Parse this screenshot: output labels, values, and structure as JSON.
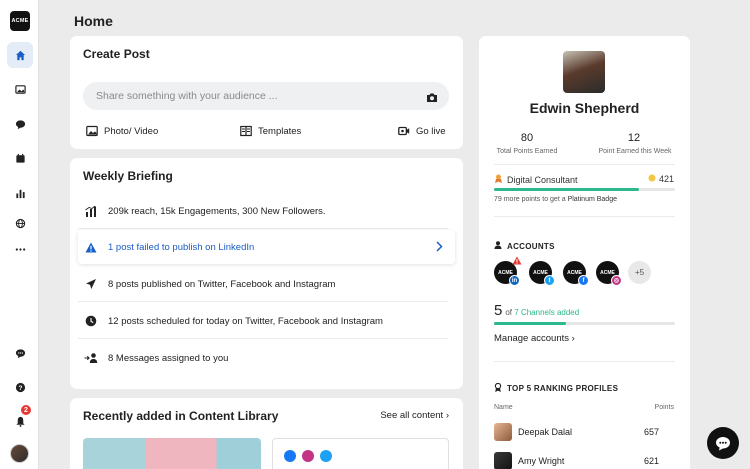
{
  "sidebar": {
    "logo_text": "ACME",
    "notification_count": "2"
  },
  "page": {
    "title": "Home"
  },
  "create_post": {
    "title": "Create Post",
    "placeholder": "Share something with your audience ...",
    "actions": {
      "photo_video": "Photo/ Video",
      "templates": "Templates",
      "go_live": "Go live"
    }
  },
  "briefing": {
    "title": "Weekly Briefing",
    "items": [
      "209k reach, 15k Engagements, 300 New Followers.",
      "1 post failed to publish on LinkedIn",
      "8 posts published on Twitter, Facebook and Instagram",
      "12 posts scheduled for today on Twitter, Facebook and Instagram",
      "8 Messages assigned to you"
    ]
  },
  "library": {
    "title": "Recently added in Content Library",
    "see_all": "See all content ›"
  },
  "profile": {
    "name": "Edwin Shepherd",
    "total_points": "80",
    "total_points_label": "Total Points Earned",
    "week_points": "12",
    "week_points_label": "Point Earned this Week",
    "role": "Digital Consultant",
    "role_points": "421",
    "badge_progress": 0.8,
    "more_points_prefix": "79 more points to get a",
    "more_points_badge": "Platinum Badge",
    "accounts_heading": "ACCOUNTS",
    "account_logo": "ACME",
    "accounts_more": "+5",
    "channels_count": "5",
    "channels_of": "of",
    "channels_total": "7",
    "channels_suffix": "Channels added",
    "channels_progress": 0.4,
    "manage": "Manage accounts ›",
    "ranking_heading": "TOP 5 RANKING PROFILES",
    "col_name": "Name",
    "col_points": "Points",
    "rankings": [
      {
        "name": "Deepak Dalal",
        "points": "657"
      },
      {
        "name": "Amy Wright",
        "points": "621"
      }
    ]
  },
  "colors": {
    "accent_blue": "#1a5ec7",
    "teal": "#2ab88c",
    "alert_red": "#e53935"
  }
}
